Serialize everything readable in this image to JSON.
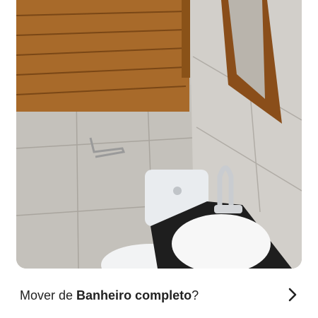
{
  "photo": {
    "subject": "bathroom-photo"
  },
  "prompt": {
    "prefix": "Mover de ",
    "album_name": "Banheiro completo",
    "suffix": "?"
  },
  "icons": {
    "chevron": "chevron-right-icon"
  },
  "colors": {
    "text": "#222222",
    "background": "#ffffff"
  }
}
